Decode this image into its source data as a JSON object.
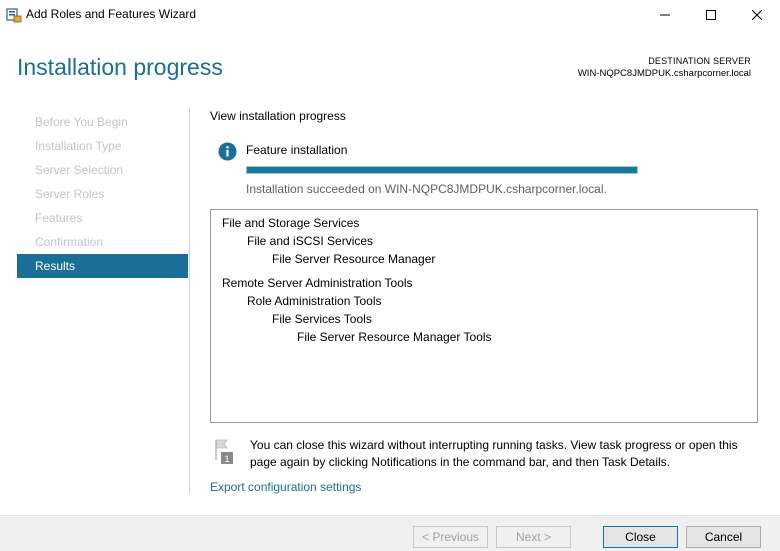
{
  "window": {
    "title": "Add Roles and Features Wizard"
  },
  "header": {
    "page_title": "Installation progress",
    "destination_label": "DESTINATION SERVER",
    "destination_server": "WIN-NQPC8JMDPUK.csharpcorner.local"
  },
  "nav": {
    "items": [
      {
        "label": "Before You Begin",
        "active": false
      },
      {
        "label": "Installation Type",
        "active": false
      },
      {
        "label": "Server Selection",
        "active": false
      },
      {
        "label": "Server Roles",
        "active": false
      },
      {
        "label": "Features",
        "active": false
      },
      {
        "label": "Confirmation",
        "active": false
      },
      {
        "label": "Results",
        "active": true
      }
    ]
  },
  "main": {
    "heading": "View installation progress",
    "feature_label": "Feature installation",
    "progress_percent": 100,
    "status": "Installation succeeded on WIN-NQPC8JMDPUK.csharpcorner.local.",
    "results": [
      {
        "text": "File and Storage Services",
        "level": 0
      },
      {
        "text": "File and iSCSI Services",
        "level": 1
      },
      {
        "text": "File Server Resource Manager",
        "level": 2
      },
      {
        "text": "Remote Server Administration Tools",
        "level": 0
      },
      {
        "text": "Role Administration Tools",
        "level": 1
      },
      {
        "text": "File Services Tools",
        "level": 2
      },
      {
        "text": "File Server Resource Manager Tools",
        "level": 3
      }
    ],
    "note": "You can close this wizard without interrupting running tasks. View task progress or open this page again by clicking Notifications in the command bar, and then Task Details.",
    "export_link": "Export configuration settings"
  },
  "footer": {
    "previous_label": "< Previous",
    "next_label": "Next >",
    "close_label": "Close",
    "cancel_label": "Cancel"
  },
  "colors": {
    "accent": "#1b6e98",
    "progress": "#107c9a",
    "nav_disabled": "#c4c4c4"
  },
  "icons": {
    "app": "server-manager-icon",
    "info": "info-icon",
    "note": "flag-notification-icon"
  }
}
